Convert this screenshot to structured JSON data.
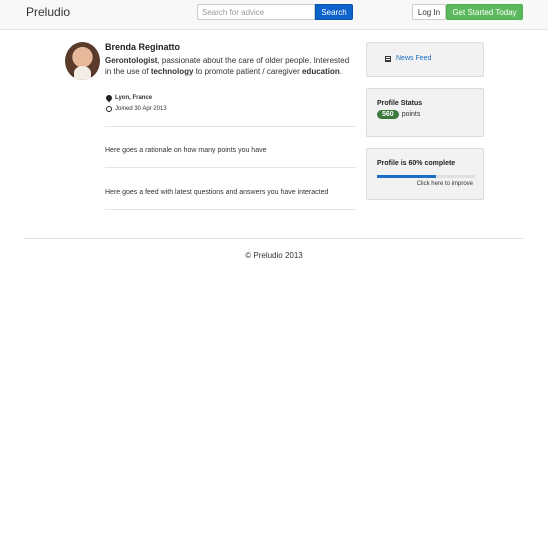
{
  "navbar": {
    "brand": "Preludio",
    "search_placeholder": "Search for advice",
    "search_label": "Search",
    "login_label": "Log In",
    "get_started_label": "Get Started Today"
  },
  "profile": {
    "name": "Brenda Reginatto",
    "bio_parts": [
      "Gerontologist",
      ", passionate about the care of older people. Interested in the use of ",
      "technology",
      " to promote patient / caregiver ",
      "education",
      "."
    ],
    "location": "Lyon, France",
    "joined": "Joined 30 Apr 2013"
  },
  "main": {
    "points_text": "Here goes a rationale on how many points you have",
    "feed_text": "Here goes a feed with latest questions and answers you have interacted"
  },
  "sidebar": {
    "news_feed_label": "News Feed",
    "profile_status_title": "Profile Status",
    "points_value": "560",
    "points_label": "points",
    "completion_title": "Profile is 60% complete",
    "completion_fraction": 0.6,
    "improve_label": "Click here to improve"
  },
  "footer": {
    "copyright": "© Preludio 2013"
  },
  "colors": {
    "primary": "#0d63c9",
    "success": "#5cb85c",
    "badge": "#3c7a3c",
    "link": "#1a6fc4"
  }
}
